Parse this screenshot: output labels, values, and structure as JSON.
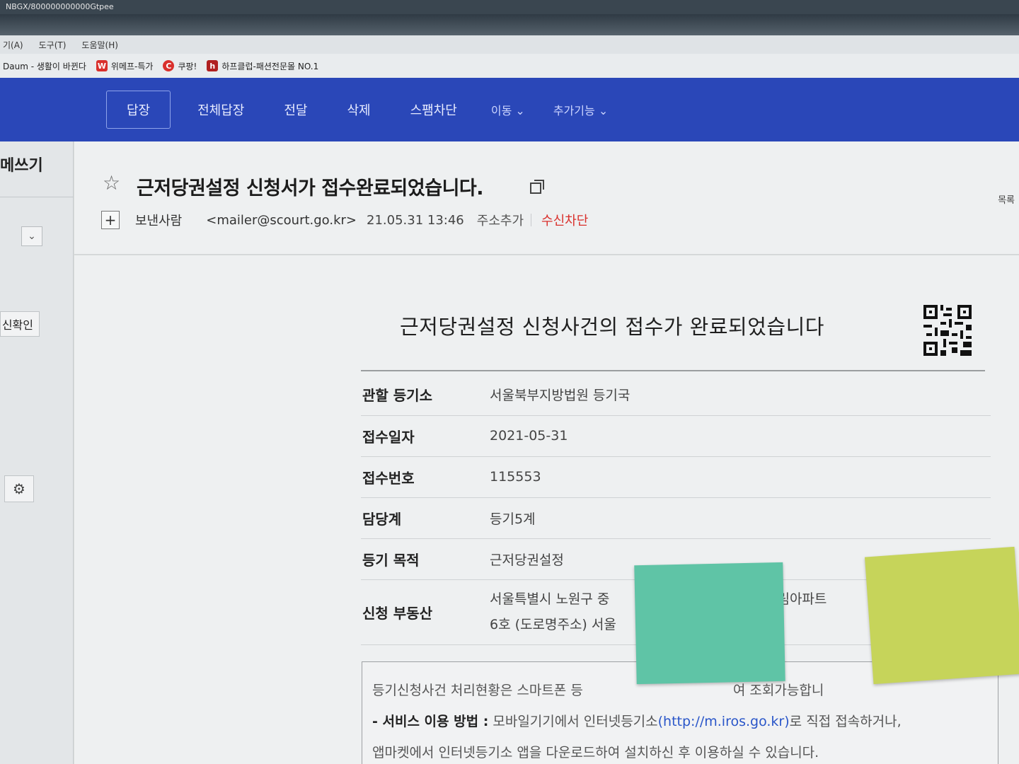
{
  "window": {
    "title_fragment": "NBGX/800000000000Gtpee"
  },
  "menubar": {
    "items": [
      "기(A)",
      "도구(T)",
      "도움말(H)"
    ]
  },
  "favorites": [
    {
      "label": "Daum - 생활이 바뀐다",
      "icon": "daum-icon",
      "color": "#d9302c"
    },
    {
      "label": "위메프-특가",
      "icon": "wemakeprice-icon",
      "color": "#d9302c",
      "glyph": "W"
    },
    {
      "label": "쿠팡!",
      "icon": "coupang-icon",
      "color": "#d9302c",
      "glyph": "C"
    },
    {
      "label": "하프클럽-패션전문몰 NO.1",
      "icon": "halfclub-icon",
      "color": "#b02020",
      "glyph": "h"
    }
  ],
  "toolbar": {
    "reply": "답장",
    "reply_all": "전체답장",
    "forward": "전달",
    "delete": "삭제",
    "spam_block": "스팸차단",
    "move": "이동",
    "more": "추가기능"
  },
  "sidebar": {
    "write": "메쓰기",
    "confirm": "신확인"
  },
  "mail": {
    "subject": "근저당권설정 신청서가 접수완료되었습니다.",
    "list_link": "목록",
    "from_label": "보낸사람",
    "from_email": "<mailer@scourt.go.kr>",
    "date": "21.05.31 13:46",
    "add_address": "주소추가",
    "block_receive": "수신차단"
  },
  "document": {
    "title": "근저당권설정 신청사건의 접수가 완료되었습니다",
    "rows": [
      {
        "key": "관할 등기소",
        "value": "서울북부지방법원 등기국"
      },
      {
        "key": "접수일자",
        "value": "2021-05-31"
      },
      {
        "key": "접수번호",
        "value": "115553"
      },
      {
        "key": "담당계",
        "value": "등기5계"
      },
      {
        "key": "등기 목적",
        "value": "근저당권설정"
      }
    ],
    "property_key": "신청 부동산",
    "property_line1": "서울특별시 노원구 중",
    "property_line1_tail": "지대림아파트",
    "property_line2": "6호 (도로명주소) 서울",
    "notice_line1": "등기신청사건 처리현황은 스마트폰 등",
    "notice_line1_tail": "여 조회가능합니",
    "notice_label": "- 서비스 이용 방법 :",
    "notice_line2a": "모바일기기에서 인터넷등기소",
    "notice_link": "(http://m.iros.go.kr)",
    "notice_line2b": "로 직접 접속하거나,",
    "notice_line3": "앱마켓에서 인터넷등기소 앱을 다운로드하여 설치하신 후 이용하실 수 있습니다."
  },
  "colors": {
    "toolbar_blue": "#2a47b8",
    "block_red": "#d9302c",
    "link_blue": "#2a56c9",
    "sticky_green": "#5fc4a6",
    "sticky_yellow": "#c6d45a"
  }
}
